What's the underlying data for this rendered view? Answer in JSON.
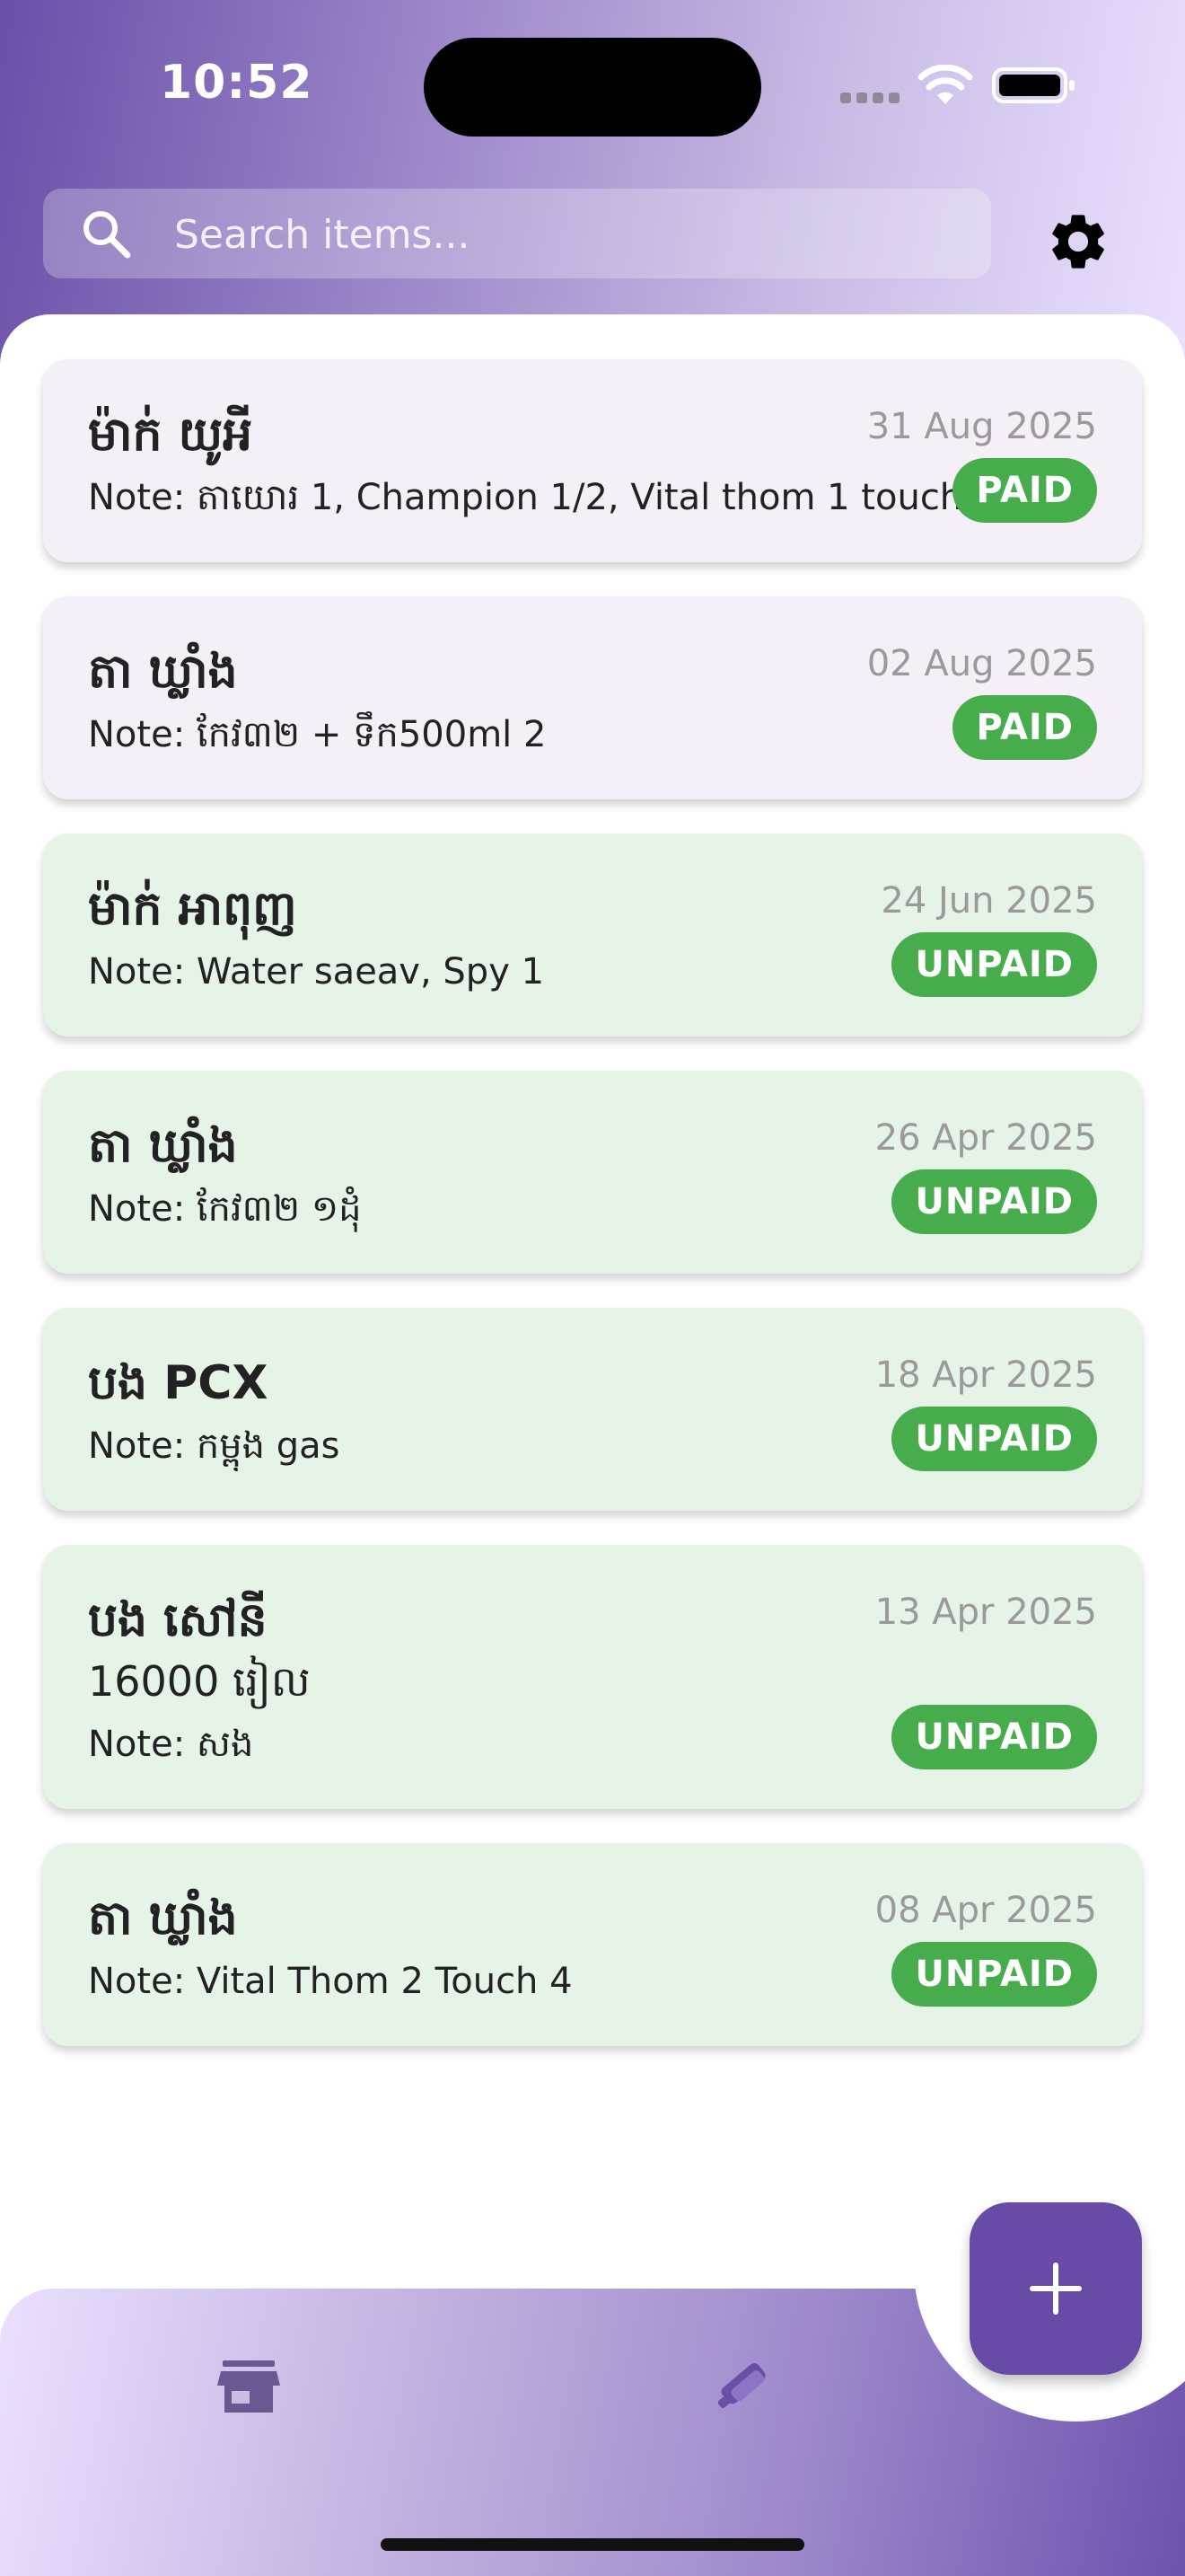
{
  "status_bar": {
    "time": "10:52"
  },
  "search": {
    "placeholder": "Search items..."
  },
  "items": [
    {
      "name": "ម៉ាក់ យូអី",
      "amount": "",
      "note": "Note: តាយោរ 1, Champion 1/2, Vital thom 1 touch",
      "date": "31 Aug 2025",
      "status": "PAID"
    },
    {
      "name": "តា ឃ្លាំង",
      "amount": "",
      "note": "Note: កែវ៣២ + ទឹក500ml 2",
      "date": "02 Aug 2025",
      "status": "PAID"
    },
    {
      "name": "ម៉ាក់ អាពុញ",
      "amount": "",
      "note": "Note: Water saeav, Spy 1",
      "date": "24 Jun 2025",
      "status": "UNPAID"
    },
    {
      "name": "តា ឃ្លាំង",
      "amount": "",
      "note": "Note: កែវ៣២ ១ដុំ",
      "date": "26 Apr 2025",
      "status": "UNPAID"
    },
    {
      "name": "បង PCX",
      "amount": "",
      "note": "Note: កម្ពុង gas",
      "date": "18 Apr 2025",
      "status": "UNPAID"
    },
    {
      "name": "បង សៅនី",
      "amount": "16000 រៀល",
      "note": "Note: សង",
      "date": "13 Apr 2025",
      "status": "UNPAID"
    },
    {
      "name": "តា ឃ្លាំង",
      "amount": "",
      "note": "Note: Vital Thom 2 Touch 4",
      "date": "08 Apr 2025",
      "status": "UNPAID"
    }
  ],
  "icons": {
    "search": "search-icon",
    "settings": "gear-icon",
    "add": "plus-icon",
    "nav_store": "store-icon",
    "nav_deals": "handshake-icon"
  },
  "colors": {
    "accent": "#674ba6",
    "paid_card": "#f5eff7",
    "unpaid_card": "#e6f4e8",
    "badge": "#47ad4c"
  }
}
